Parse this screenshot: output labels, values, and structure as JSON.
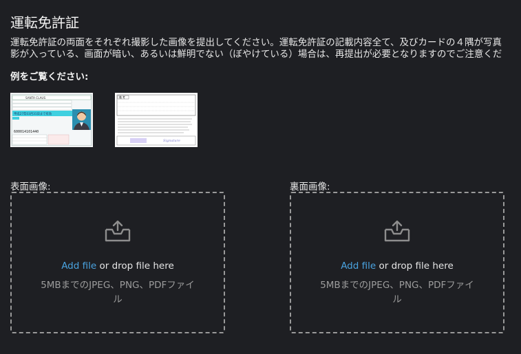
{
  "page": {
    "title": "運転免許証",
    "description_line1": "運転免許証の両面をそれぞれ撮影した画像を提出してください。運転免許証の記載内容全て、及びカードの４隅が写真",
    "description_line2": "影が入っている、画面が暗い、あるいは鮮明でない（ぼやけている）場合は、再提出が必要となりますのでご注意くだ",
    "example_label": "例をご覧ください:"
  },
  "samples": {
    "front": {
      "name_text": "SANTA CLAUS",
      "number_text": "600014101440",
      "expiry_text": "平成27年03月31日まで有効"
    },
    "back": {
      "header_text": "備 考",
      "signature_text": "Signature"
    }
  },
  "upload": {
    "front": {
      "label": "表面画像:",
      "add_file": "Add file",
      "drop_text": " or drop file here",
      "hint": "5MBまでのJPEG、PNG、PDFファイル"
    },
    "back": {
      "label": "裏面画像:",
      "add_file": "Add file",
      "drop_text": " or drop file here",
      "hint": "5MBまでのJPEG、PNG、PDFファイル"
    }
  },
  "colors": {
    "background": "#1e1f23",
    "link": "#4aa3e0",
    "dashed_border": "#9a9a9a",
    "hint_text": "#9c9c9c",
    "license_cyan": "#3fd0e0"
  },
  "icons": {
    "upload": "inbox-upload-icon"
  }
}
